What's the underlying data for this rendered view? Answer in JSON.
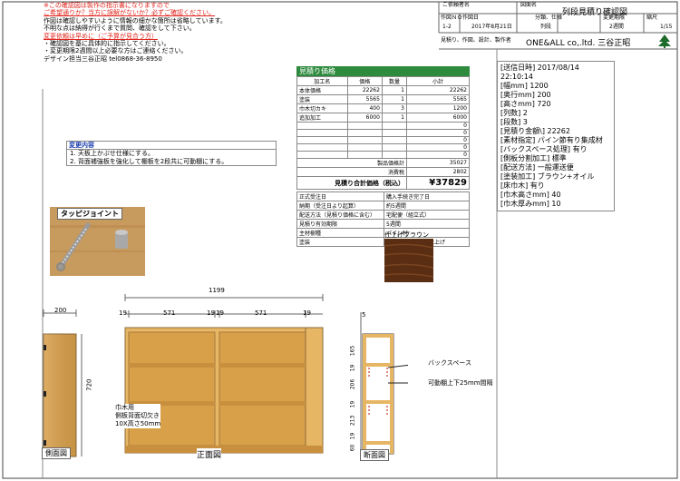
{
  "header": {
    "customer_label": "ご依頼者名",
    "drawing_name_label": "図面名",
    "drawing_name": "列段見積り確認図",
    "work_no_label": "作図ＮＯ",
    "work_no": "1-2",
    "date_label": "作図日",
    "date": "2017年8月21日",
    "category_label": "分類、仕様",
    "category": "列段",
    "change_label": "変更期限",
    "change": "2週間",
    "scale_label": "縮尺",
    "scale": "1/15",
    "maker_line": "見積り、作図、設計、製作者",
    "company": "ONE&ALL co,.ltd.  三谷正昭"
  },
  "notes": {
    "line1": "※この確認図は製作の指示書になりますので",
    "line2": "ご希望通りか？当方に誤解がないか？必ずご確認ください。",
    "line3": "作図は確認しやすいように情報の細かな箇所は省略しています。",
    "line4": "不明な点は納得が行くまで質問、確認をして下さい。",
    "line5": "変更依頼は早めに（ご予算が見合う方）",
    "line6": "・確認図を基に具体的に指示してください。",
    "line7": "・変更期限2週間以上必要な方はご連絡ください。",
    "line8": "デザイン担当三谷正昭  tel0868-36-8950"
  },
  "change_box": {
    "title": "変更内容",
    "item1": "1. 天板上かぶせ仕様にする。",
    "item2": "2. 背面補強板を強化して棚板を2段共に可動棚にする。"
  },
  "estimate": {
    "title": "見積り価格",
    "col_name": "加工名",
    "col_price": "価格",
    "col_qty": "数量",
    "col_subtotal": "小計",
    "rows": [
      {
        "name": "本体価格",
        "price": "22262",
        "qty": "1",
        "sub": "22262"
      },
      {
        "name": "塗装",
        "price": "5565",
        "qty": "1",
        "sub": "5565"
      },
      {
        "name": "巾木切カキ",
        "price": "400",
        "qty": "3",
        "sub": "1200"
      },
      {
        "name": "追加加工",
        "price": "6000",
        "qty": "1",
        "sub": "6000"
      },
      {
        "name": "",
        "price": "",
        "qty": "",
        "sub": "0"
      },
      {
        "name": "",
        "price": "",
        "qty": "",
        "sub": "0"
      },
      {
        "name": "",
        "price": "",
        "qty": "",
        "sub": "0"
      },
      {
        "name": "",
        "price": "",
        "qty": "",
        "sub": "0"
      },
      {
        "name": "",
        "price": "",
        "qty": "",
        "sub": "0"
      }
    ],
    "product_total_label": "製品価格計",
    "product_total": "35027",
    "tax_label": "消費税",
    "tax": "2802",
    "grand_label": "見積り合計価格（税込）",
    "grand": "¥37829",
    "info": [
      {
        "k": "正式受注日",
        "v": "購入手続き完了日"
      },
      {
        "k": "納期（受注日より起算）",
        "v": "約5週間"
      },
      {
        "k": "配送方法（見積り価格に含む）",
        "v": "宅配便（組立式）"
      },
      {
        "k": "見積り有効期限",
        "v": "5週間"
      },
      {
        "k": "主材樹種",
        "v": "パイン材"
      },
      {
        "k": "塗装",
        "v": "ブラウン+オイル仕上げ"
      }
    ]
  },
  "spec": {
    "lines": [
      "[送信日時] 2017/08/14 22:10:14",
      "[幅mm] 1200",
      "[奥行mm] 200",
      "[高さmm] 720",
      "[列数] 2",
      "[段数] 3",
      "[見積り金額\\] 22262",
      "[素材指定] パイン節有り集成材",
      "[バックスペース処理] 有り",
      "[側板分割加工] 標準",
      "[配送方法] 一般運送便",
      "[塗装加工] ブラウン+オイル",
      "[床巾木] 有り",
      "[巾木高さmm] 40",
      "[巾木厚みmm] 10"
    ]
  },
  "joint_label": "タッピジョイント",
  "finish_label": "仕上げブラウン",
  "views": {
    "side": "側面図",
    "front": "正面図",
    "section": "断面図"
  },
  "dims": {
    "side_depth": "200",
    "height": "720",
    "total_width": "1199",
    "d19a": "19",
    "d571a": "571",
    "d19b": "19",
    "d19c": "19",
    "d571b": "571",
    "d19d": "19",
    "sec_top": "5",
    "s165": "165",
    "s19a": "19",
    "s206": "206",
    "s19b": "19",
    "s213": "213",
    "s19c": "19",
    "s60": "60"
  },
  "annotations": {
    "baseboard_1": "巾木用",
    "baseboard_2": "側板背面切欠き",
    "baseboard_3": "10X高さ50mm",
    "back_space": "バックスペース",
    "movable": "可動棚上下25mm間隔"
  },
  "colors": {
    "green_header": "#2e8b3e",
    "red_text": "#e0241c",
    "wood": "#d9a04a",
    "brown_finish": "#5a2e12"
  }
}
